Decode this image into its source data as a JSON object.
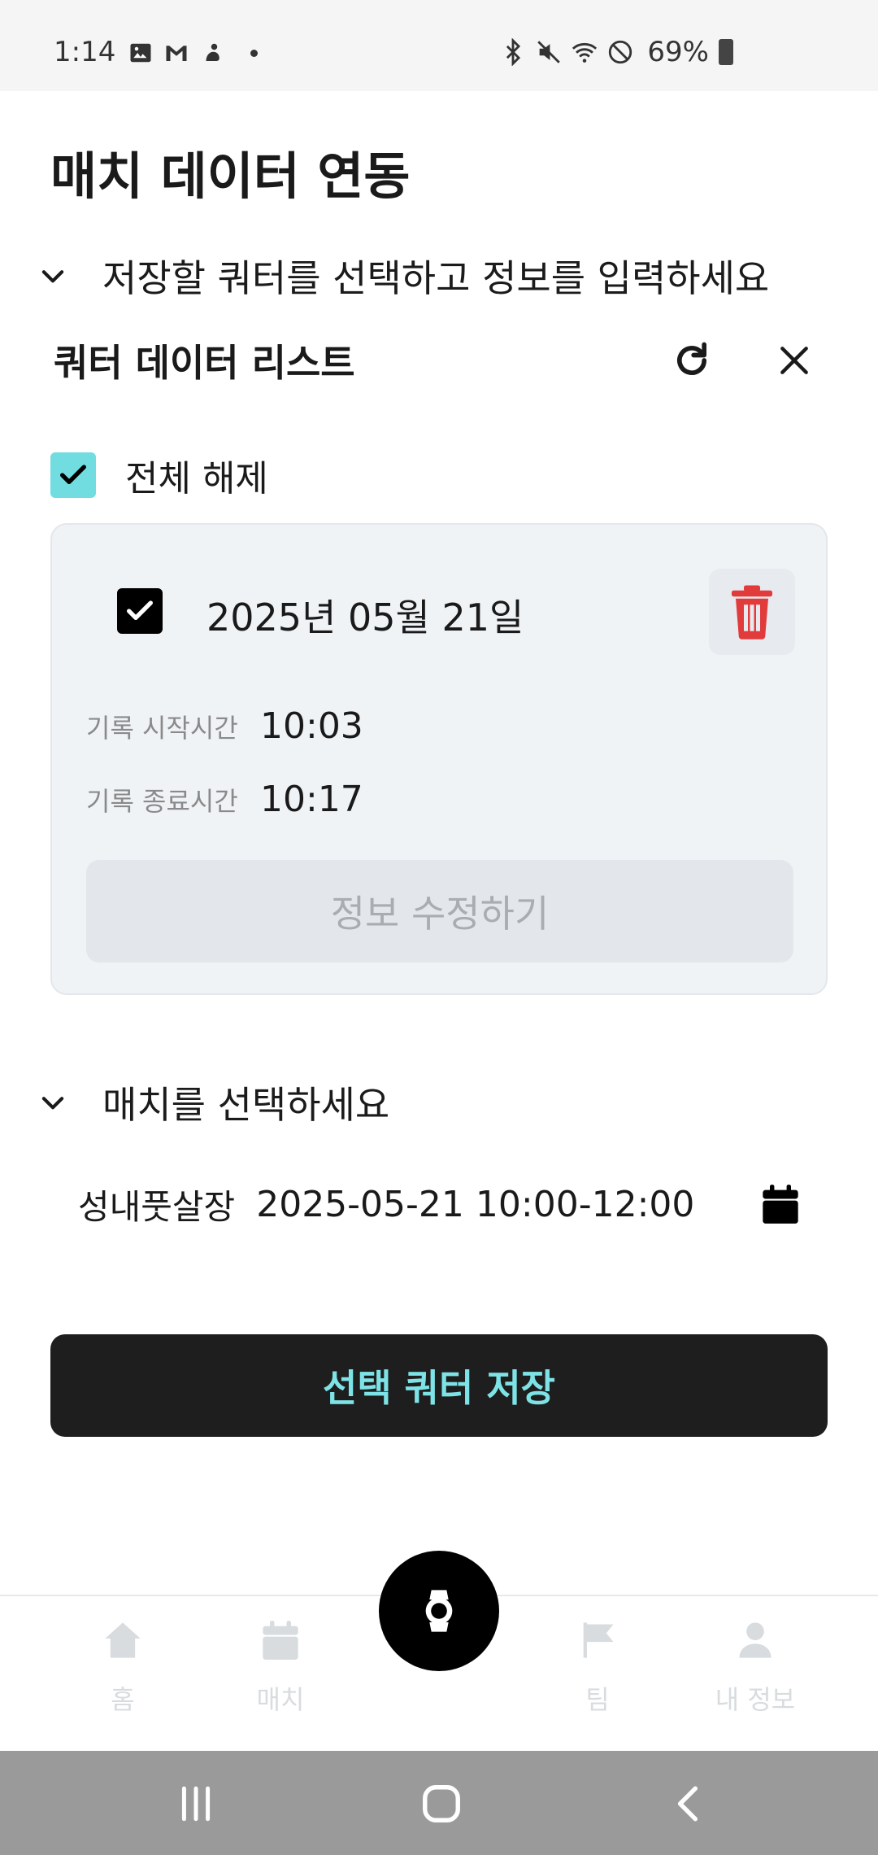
{
  "status_bar": {
    "time": "1:14",
    "battery": "69%",
    "left_icons": [
      "image-icon",
      "gmail-icon",
      "app-icon"
    ],
    "right_icons": [
      "bluetooth-icon",
      "mute-icon",
      "wifi-icon",
      "dnd-icon",
      "battery-icon"
    ]
  },
  "page": {
    "title": "매치 데이터 연동"
  },
  "quarter_section": {
    "label": "저장할 쿼터를 선택하고 정보를 입력하세요"
  },
  "quarter_list": {
    "title": "쿼터 데이터 리스트",
    "select_all_label": "전체 해제",
    "select_all_checked": true,
    "items": [
      {
        "checked": true,
        "date": "2025년 05월 21일",
        "start_label": "기록 시작시간",
        "start_value": "10:03",
        "end_label": "기록 종료시간",
        "end_value": "10:17",
        "edit_label": "정보 수정하기"
      }
    ]
  },
  "match_section": {
    "label": "매치를 선택하세요",
    "place": "성내풋살장",
    "datetime": "2025-05-21 10:00-12:00"
  },
  "save_button": {
    "label": "선택 쿼터 저장"
  },
  "bottom_nav": {
    "items": [
      {
        "label": "홈",
        "icon": "home-icon"
      },
      {
        "label": "매치",
        "icon": "calendar-icon"
      },
      {
        "label": "팀",
        "icon": "flag-icon"
      },
      {
        "label": "내 정보",
        "icon": "person-icon"
      }
    ],
    "center_icon": "watch-icon"
  },
  "colors": {
    "accent": "#72dde1",
    "save_text": "#7ee3e6",
    "delete": "#e23b3b",
    "card_bg": "#f0f3f6",
    "nav_inactive": "#d8dcdf"
  }
}
